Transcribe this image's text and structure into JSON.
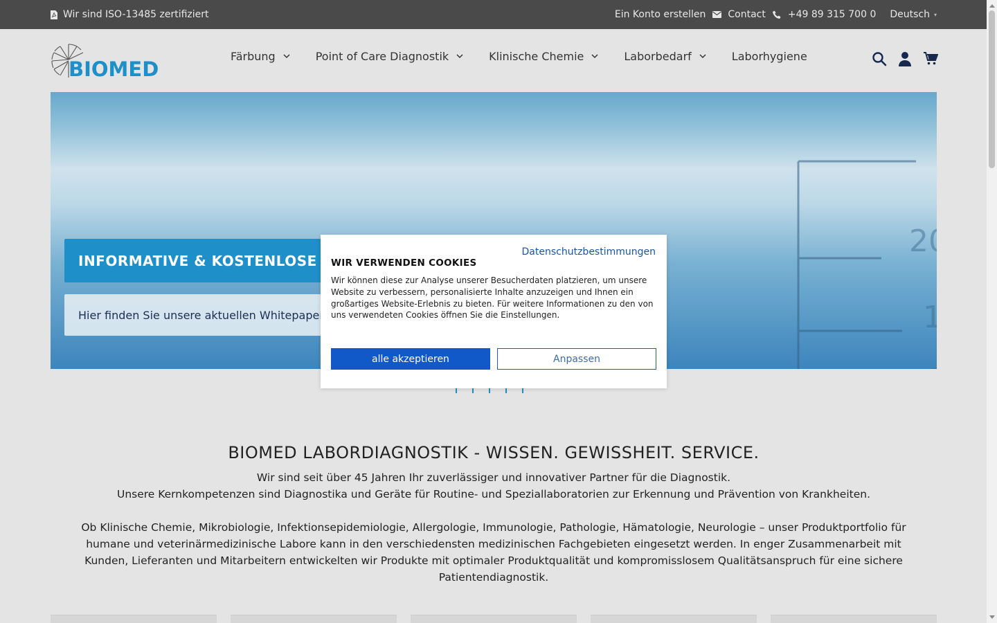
{
  "topbar": {
    "iso_text": "Wir sind ISO-13485 zertifiziert",
    "create_account": "Ein Konto erstellen",
    "contact": "Contact",
    "phone": "+49 89 315 700 0",
    "language": "Deutsch"
  },
  "header": {
    "logo_text": "BIOMED",
    "nav": [
      {
        "label": "Färbung",
        "has_dropdown": true
      },
      {
        "label": "Point of Care Diagnostik",
        "has_dropdown": true
      },
      {
        "label": "Klinische Chemie",
        "has_dropdown": true
      },
      {
        "label": "Laborbedarf",
        "has_dropdown": true
      },
      {
        "label": "Laborhygiene",
        "has_dropdown": false
      }
    ],
    "icons": [
      "search-icon",
      "user-icon",
      "cart-icon"
    ]
  },
  "hero": {
    "title": "INFORMATIVE & KOSTENLOSE W",
    "subtitle": "Hier finden Sie unsere aktuellen Whitepaper"
  },
  "intro": {
    "heading": "BIOMED LABORDIAGNOSTIK - WISSEN. GEWISSHEIT. SERVICE.",
    "line1": "Wir sind seit über 45 Jahren Ihr zuverlässiger und innovativer Partner für die Diagnostik.",
    "line2": "Unsere Kernkompetenzen sind Diagnostika und Geräte für Routine- und Speziallaboratorien zur Erkennung und Prävention von Krankheiten.",
    "paragraph": "Ob Klinische Chemie, Mikrobiologie, Infektionsepidemiologie, Allergologie, Immunologie, Pathologie, Hämatologie, Neurologie – unser Produktportfolio für humane und veterinärmedizinische Labore kann in den verschiedensten medizinischen Fachgebieten eingesetzt werden. In enger Zusammenarbeit mit Kunden, Lieferanten und Mitarbeitern entwickelten wir Produkte mit optimaler Produktqualität und kompromisslosem Qualitätsanspruch für eine sichere Patientendiagnostik."
  },
  "cookie": {
    "privacy_link": "Datenschutzbestimmungen",
    "title": "WIR VERWENDEN COOKIES",
    "text": "Wir können diese zur Analyse unserer Besucherdaten platzieren, um unsere Website zu verbessern, personalisierte Inhalte anzuzeigen und Ihnen ein großartiges Website-Erlebnis zu bieten. Für weitere Informationen zu den von uns verwendeten Cookies öffnen Sie die Einstellungen.",
    "accept_label": "alle akzeptieren",
    "customize_label": "Anpassen"
  },
  "colors": {
    "topbar_bg": "#4a4a4a",
    "brand_blue": "#1e8fc8",
    "accept_blue": "#1159c9",
    "page_bg": "#e4e4e4"
  }
}
